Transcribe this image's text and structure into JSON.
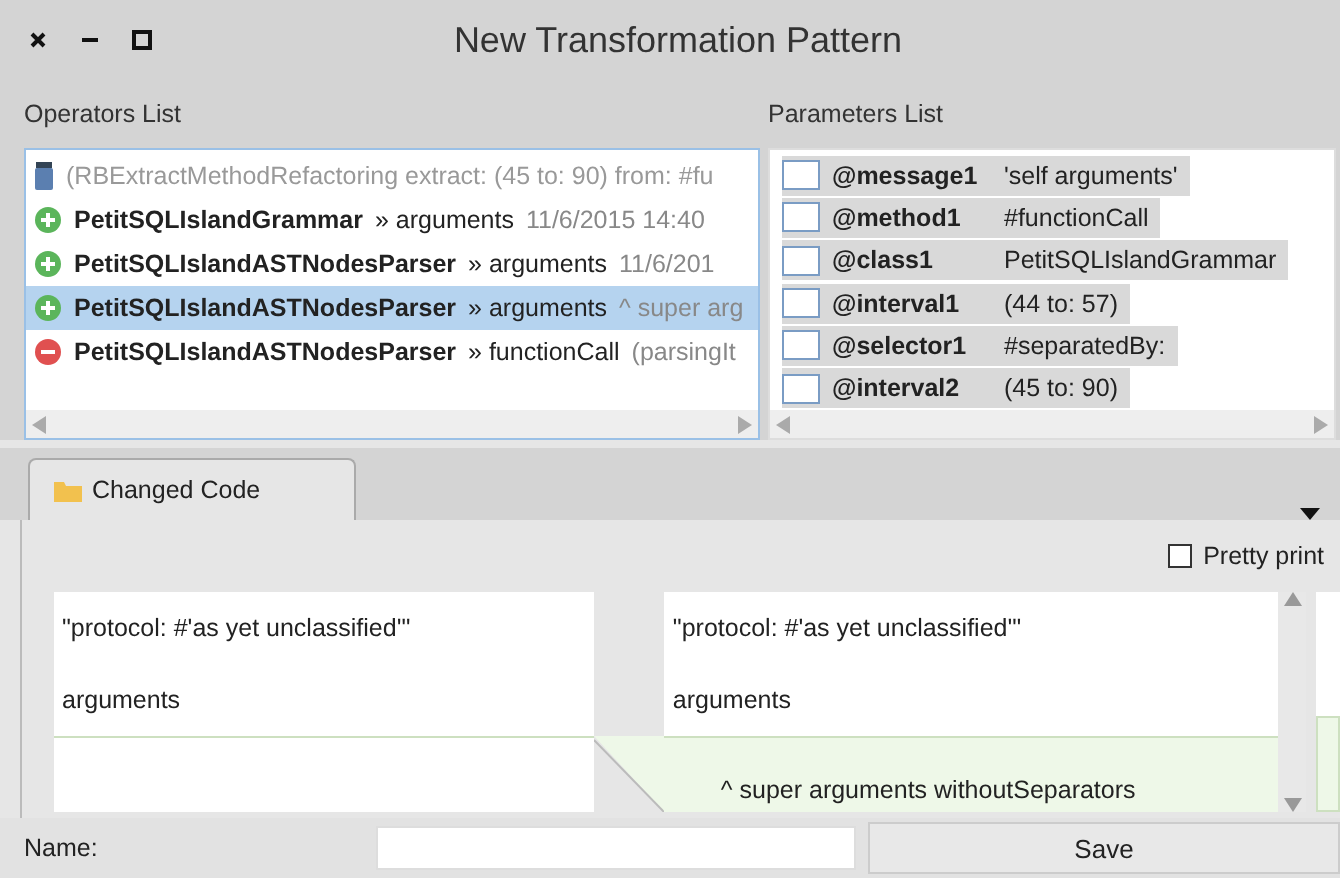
{
  "window": {
    "title": "New Transformation Pattern"
  },
  "operators": {
    "label": "Operators List",
    "items": [
      {
        "kind": "refactoring",
        "selected": false,
        "text": "(RBExtractMethodRefactoring extract: (45 to: 90) from: #fu"
      },
      {
        "kind": "added",
        "selected": false,
        "class": "PetitSQLIslandGrammar",
        "method": "» arguments",
        "detail": "11/6/2015 14:40"
      },
      {
        "kind": "added",
        "selected": false,
        "class": "PetitSQLIslandASTNodesParser",
        "method": "» arguments",
        "detail": "11/6/201"
      },
      {
        "kind": "added",
        "selected": true,
        "class": "PetitSQLIslandASTNodesParser",
        "method": "» arguments",
        "detail": "^ super arg"
      },
      {
        "kind": "removed",
        "selected": false,
        "class": "PetitSQLIslandASTNodesParser",
        "method": "» functionCall",
        "detail": "(parsingIt"
      }
    ]
  },
  "parameters": {
    "label": "Parameters List",
    "items": [
      {
        "name": "@message1",
        "value": "'self arguments'",
        "checked": false
      },
      {
        "name": "@method1",
        "value": "#functionCall",
        "checked": false
      },
      {
        "name": "@class1",
        "value": "PetitSQLIslandGrammar",
        "checked": false
      },
      {
        "name": "@interval1",
        "value": "(44 to: 57)",
        "checked": false
      },
      {
        "name": "@selector1",
        "value": "#separatedBy:",
        "checked": false
      },
      {
        "name": "@interval2",
        "value": "(45 to: 90)",
        "checked": false
      }
    ]
  },
  "tabs": [
    {
      "label": "Changed Code",
      "selected": true
    }
  ],
  "pretty_print": {
    "label": "Pretty print",
    "checked": false
  },
  "diff": {
    "left": [
      {
        "text": "\"protocol: #'as yet unclassified'\"",
        "added": false
      },
      {
        "text": "arguments",
        "added": false
      }
    ],
    "right": [
      {
        "text": "\"protocol: #'as yet unclassified'\"",
        "added": false
      },
      {
        "text": "arguments",
        "added": false
      },
      {
        "text": "^ super arguments withoutSeparators",
        "added": true
      }
    ]
  },
  "name_field": {
    "label": "Name:"
  },
  "save_button": {
    "label": "Save"
  }
}
